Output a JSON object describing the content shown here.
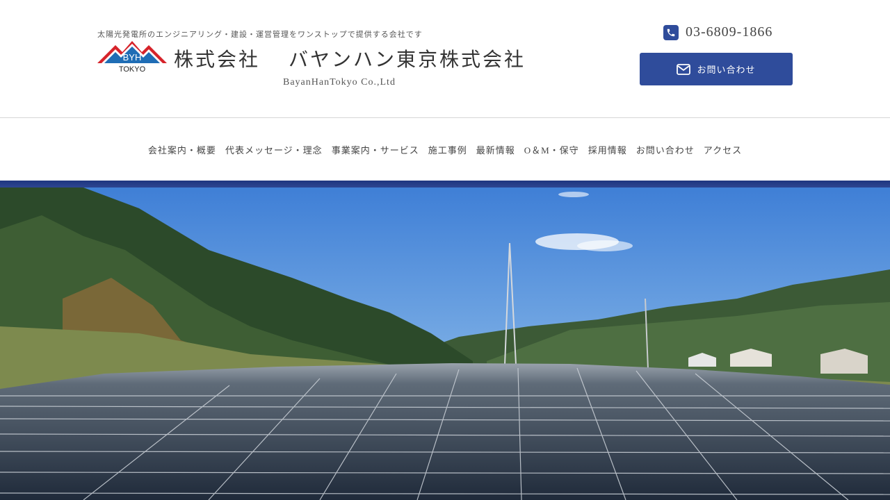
{
  "header": {
    "tagline": "太陽光発電所のエンジニアリング・建設・運営管理をワンストップで提供する会社です",
    "company_name": "株式会社　 バヤンハン東京株式会社",
    "company_name_en": "BayanHanTokyo Co.,Ltd",
    "logo_top_text": "BYH",
    "logo_bottom_text": "TOKYO",
    "phone_number": "03-6809-1866",
    "contact_button_label": "お問い合わせ",
    "icons": {
      "phone": "phone-icon",
      "mail": "mail-icon"
    }
  },
  "nav": {
    "items": [
      "会社案内・概要",
      "代表メッセージ・理念",
      "事業案内・サービス",
      "施工事例",
      "最新情報",
      "O＆M・保守",
      "採用情報",
      "お問い合わせ",
      "アクセス"
    ]
  },
  "hero": {
    "image": "solar-farm-photo"
  },
  "colors": {
    "brand_blue": "#2f4c9b",
    "logo_red": "#d6232a",
    "logo_blue": "#1f6db5"
  }
}
